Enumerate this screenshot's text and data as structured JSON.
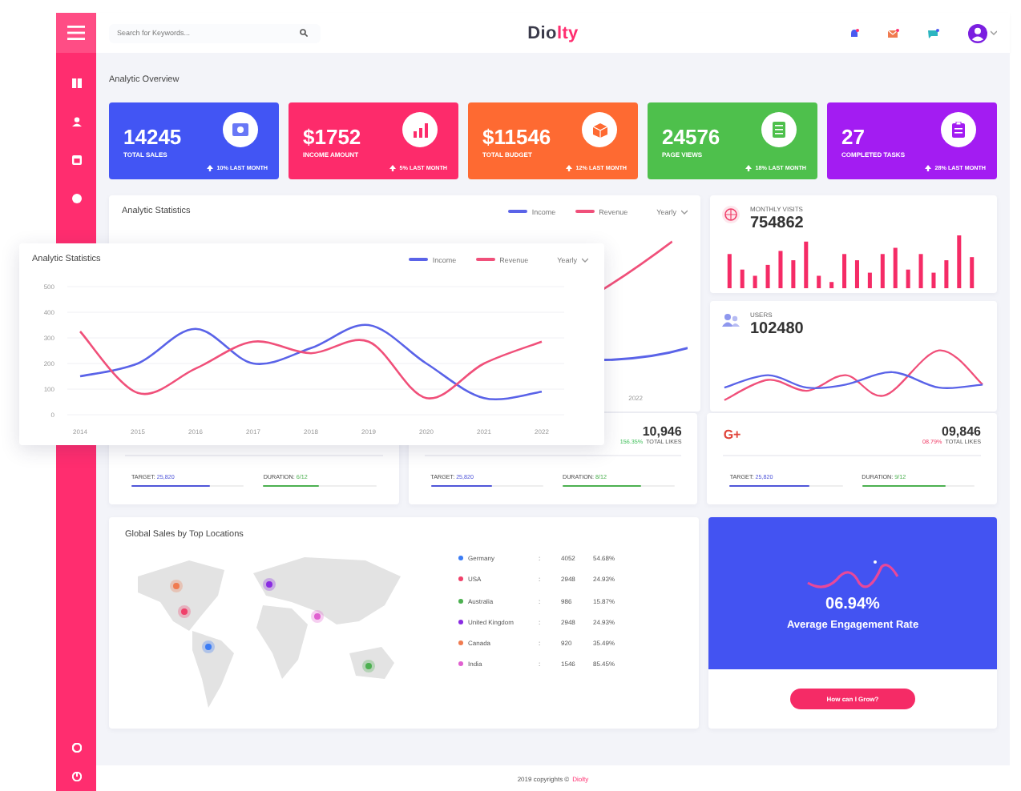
{
  "topbar": {
    "search": {
      "placeholder": "Search for Keywords..."
    },
    "logo": {
      "dark": "Dio",
      "accent": "lty"
    }
  },
  "overview": {
    "title": "Analytic Overview",
    "cards": [
      {
        "value": "14245",
        "label": "TOTAL SALES",
        "change": "10% LAST MONTH",
        "color": "#4255f4",
        "kind": "money"
      },
      {
        "value": "$1752",
        "label": "INCOME AMOUNT",
        "change": "5% LAST MONTH",
        "color": "#fd2b6b",
        "kind": "chart"
      },
      {
        "value": "$11546",
        "label": "TOTAL BUDGET",
        "change": "12% LAST MONTH",
        "color": "#fe6a32",
        "kind": "box"
      },
      {
        "value": "24576",
        "label": "PAGE VIEWS",
        "change": "18% LAST MONTH",
        "color": "#4ec04c",
        "kind": "document"
      },
      {
        "value": "27",
        "label": "COMPLETED TASKS",
        "change": "28% LAST MONTH",
        "color": "#a31cf2",
        "kind": "clipboard"
      }
    ]
  },
  "statistics": {
    "title": "Analytic Statistics",
    "legend": [
      {
        "name": "Income",
        "color": "#5a63e8"
      },
      {
        "name": "Revenue",
        "color": "#f0507a"
      }
    ],
    "period": "Yearly",
    "x_label": "2022"
  },
  "statistics_popup": {
    "title": "Analytic Statistics",
    "period": "Yearly",
    "chart_data": {
      "type": "line",
      "categories": [
        "2014",
        "2015",
        "2016",
        "2017",
        "2018",
        "2019",
        "2020",
        "2021",
        "2022"
      ],
      "ylim": [
        0,
        500
      ],
      "grid": true,
      "yticks": [
        0,
        100,
        200,
        300,
        400,
        500
      ],
      "series": [
        {
          "name": "Income",
          "color": "#5a63e8",
          "values": [
            150,
            200,
            335,
            200,
            260,
            350,
            200,
            65,
            90
          ]
        },
        {
          "name": "Revenue",
          "color": "#f0507a",
          "values": [
            325,
            85,
            180,
            285,
            240,
            285,
            65,
            200,
            285
          ]
        }
      ]
    }
  },
  "monthly_visits": {
    "label": "MONTHLY VISITS",
    "value": "754862"
  },
  "users": {
    "label": "USERS",
    "value": "102480"
  },
  "social_cards": [
    {
      "progress": [
        {
          "kind": "target",
          "label": "TARGET:",
          "value": "25,820",
          "level": 0.7
        },
        {
          "kind": "duration",
          "label": "DURATION:",
          "value": "6/12",
          "level": 0.5
        }
      ]
    },
    {
      "value": "10,946",
      "kind": "up",
      "change": "156.35%",
      "change_label": "TOTAL LIKES",
      "progress": [
        {
          "kind": "target",
          "label": "TARGET:",
          "value": "25,820",
          "level": 0.55
        },
        {
          "kind": "duration",
          "label": "DURATION:",
          "value": "8/12",
          "level": 0.7
        }
      ]
    },
    {
      "badge": "G+",
      "value": "09,846",
      "kind": "down",
      "change": "08.79%",
      "change_label": "TOTAL LIKES",
      "progress": [
        {
          "kind": "target",
          "label": "TARGET:",
          "value": "25,820",
          "level": 0.7
        },
        {
          "kind": "duration",
          "label": "DURATION:",
          "value": "9/12",
          "level": 0.75
        }
      ]
    }
  ],
  "locations": {
    "title": "Global Sales by Top Locations",
    "rows": [
      {
        "country": "Germany",
        "separator": ":",
        "sales": "4052",
        "share": "54.68%",
        "color": "#3b7cf5"
      },
      {
        "country": "USA",
        "separator": ":",
        "sales": "2948",
        "share": "24.93%",
        "color": "#f0406a"
      },
      {
        "country": "Australia",
        "separator": ":",
        "sales": "986",
        "share": "15.87%",
        "color": "#4cb050"
      },
      {
        "country": "United Kingdom",
        "separator": ":",
        "sales": "2948",
        "share": "24.93%",
        "color": "#8a2be2"
      },
      {
        "country": "Canada",
        "separator": ":",
        "sales": "920",
        "share": "35.49%",
        "color": "#f07b50"
      },
      {
        "country": "India",
        "separator": ":",
        "sales": "1546",
        "share": "85.45%",
        "color": "#e060d0"
      }
    ]
  },
  "engagement": {
    "value": "06.94%",
    "label": "Average Engagement Rate",
    "button": "How can I Grow?"
  },
  "footer": {
    "text": "2019 copyrights ©",
    "brand": "Diolty"
  }
}
